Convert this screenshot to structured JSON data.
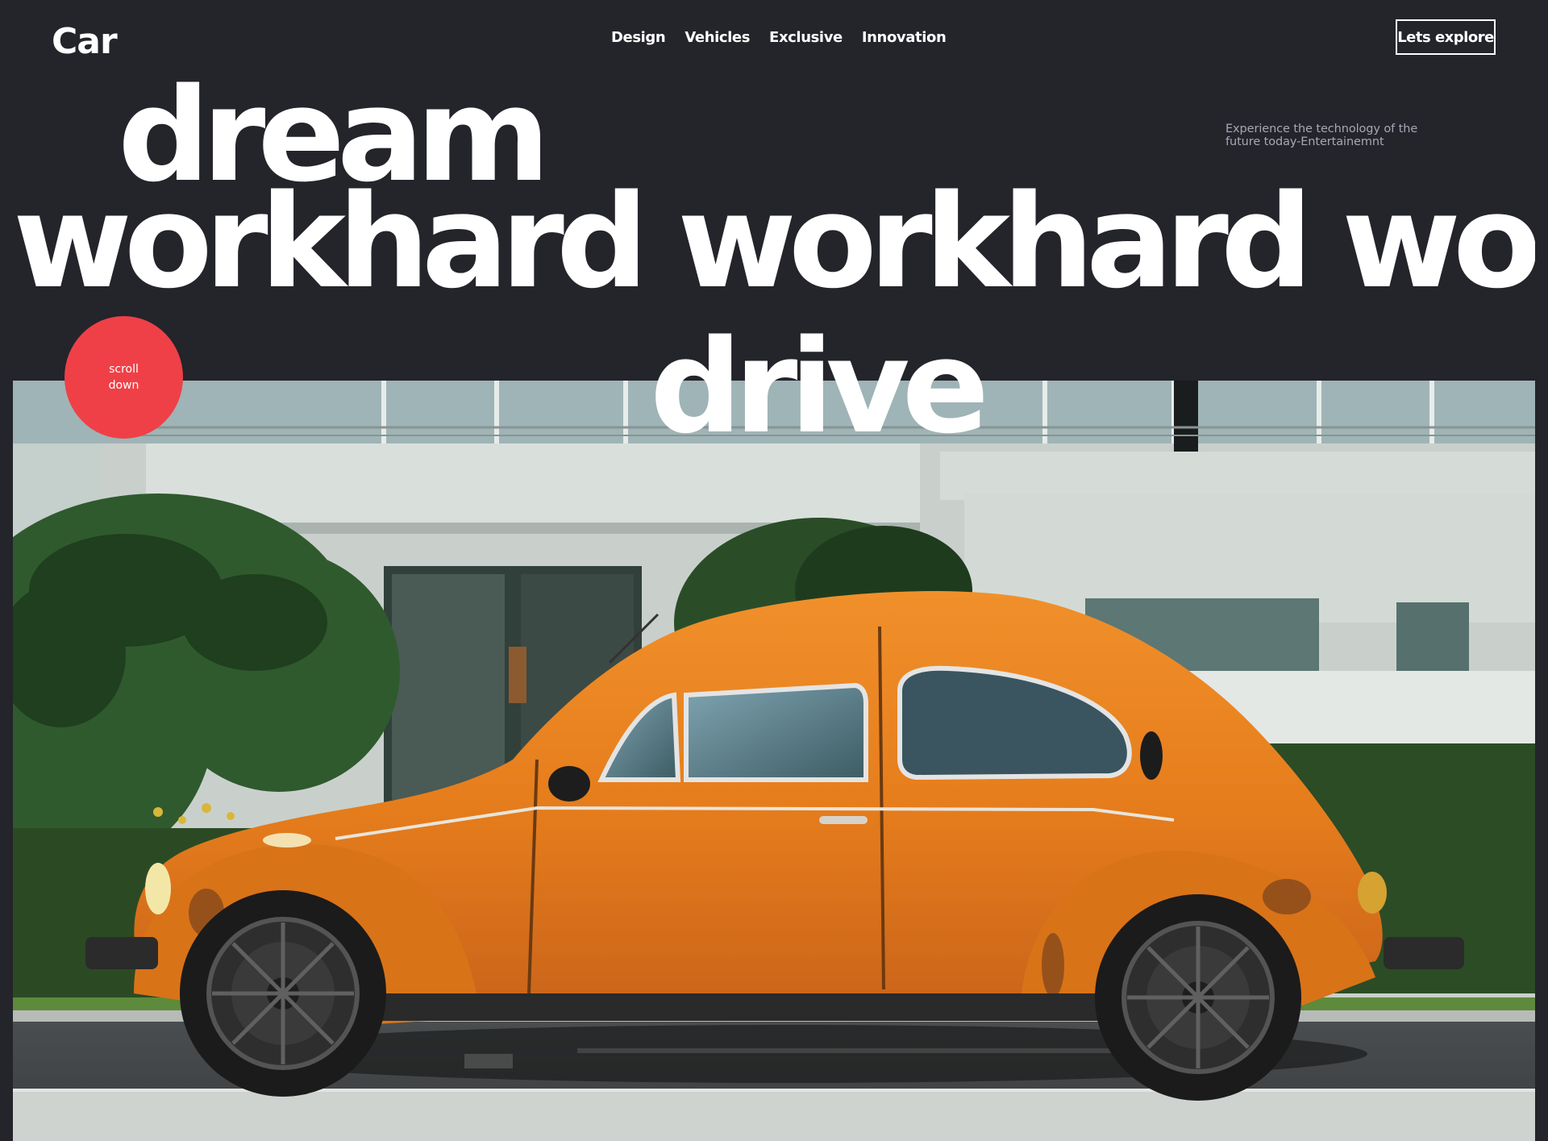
{
  "header": {
    "logo": "Car",
    "nav": [
      {
        "label": "Design"
      },
      {
        "label": "Vehicles"
      },
      {
        "label": "Exclusive"
      },
      {
        "label": "Innovation"
      }
    ],
    "cta_label": "Lets explore"
  },
  "hero": {
    "tagline": "Experience the technology of the future today-Entertainemnt",
    "line1": "dream",
    "line2": "workhard workhard workhard",
    "line3": "drive",
    "scroll_label": "scroll down",
    "image_subject": "orange-vintage-beetle-car-photo"
  },
  "colors": {
    "background": "#24242b",
    "accent": "#ef4047",
    "text": "#ffffff",
    "muted": "#a5a8b4",
    "car": "#e57f1f"
  }
}
